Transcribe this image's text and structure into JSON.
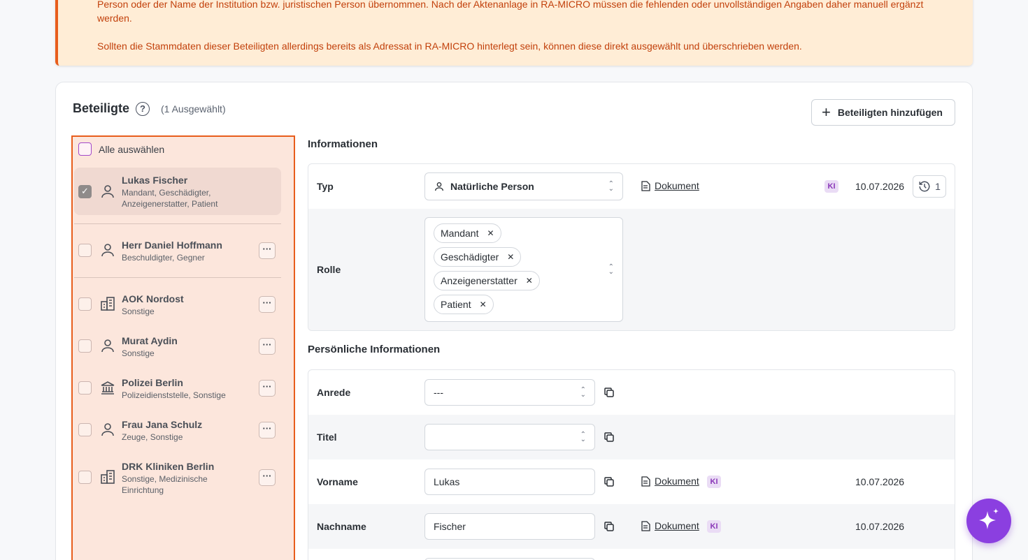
{
  "notice": {
    "line1": "Person oder der Name der Institution bzw. juristischen Person übernommen. Nach der Aktenanlage in RA-MICRO müssen die fehlenden oder unvollständigen Angaben daher manuell ergänzt werden.",
    "line2": "Sollten die Stammdaten dieser Beteiligten allerdings bereits als Adressat in RA-MICRO hinterlegt sein, können diese direkt ausgewählt und überschrieben werden.",
    "color_text": "#c2410c",
    "color_bg": "#ffedd6"
  },
  "header": {
    "title": "Beteiligte",
    "help_icon": "?",
    "count": "(1 Ausgewählt)",
    "add_button": "Beteiligten hinzufügen"
  },
  "list": {
    "select_all": "Alle auswählen",
    "items": [
      {
        "name": "Lukas Fischer",
        "roles": "Mandant, Geschädigter, Anzeigenerstatter, Patient",
        "icon": "person-icon",
        "checked": true
      },
      {
        "name": "Herr Daniel Hoffmann",
        "roles": "Beschuldigter, Gegner",
        "icon": "person-icon"
      },
      {
        "name": "AOK Nordost",
        "roles": "Sonstige",
        "icon": "building-icon"
      },
      {
        "name": "Murat Aydin",
        "roles": "Sonstige",
        "icon": "person-icon"
      },
      {
        "name": "Polizei Berlin",
        "roles": "Polizeidienststelle, Sonstige",
        "icon": "institution-icon"
      },
      {
        "name": "Frau Jana Schulz",
        "roles": "Zeuge, Sonstige",
        "icon": "person-icon"
      },
      {
        "name": "DRK Kliniken Berlin",
        "roles": "Sonstige, Medizinische Einrichtung",
        "icon": "building-icon"
      }
    ],
    "more": "···",
    "highlight_color": "#e85d1c"
  },
  "info": {
    "title": "Informationen",
    "typ_label": "Typ",
    "typ_value": "Natürliche Person",
    "doc_label": "Dokument",
    "ki": "KI",
    "date": "10.07.2026",
    "history_count": "1",
    "rolle_label": "Rolle",
    "chips": [
      "Mandant",
      "Geschädigter",
      "Anzeigenerstatter",
      "Patient"
    ],
    "chip_remove": "✕"
  },
  "personal": {
    "title": "Persönliche Informationen",
    "anrede_label": "Anrede",
    "anrede_value": "---",
    "titel_label": "Titel",
    "titel_value": "",
    "vorname_label": "Vorname",
    "vorname_value": "Lukas",
    "nachname_label": "Nachname",
    "nachname_value": "Fischer",
    "doc_label": "Dokument",
    "ki": "KI",
    "date": "10.07.2026"
  },
  "fab": {
    "icon": "sparkle-icon",
    "color": "#8b3fe0"
  }
}
